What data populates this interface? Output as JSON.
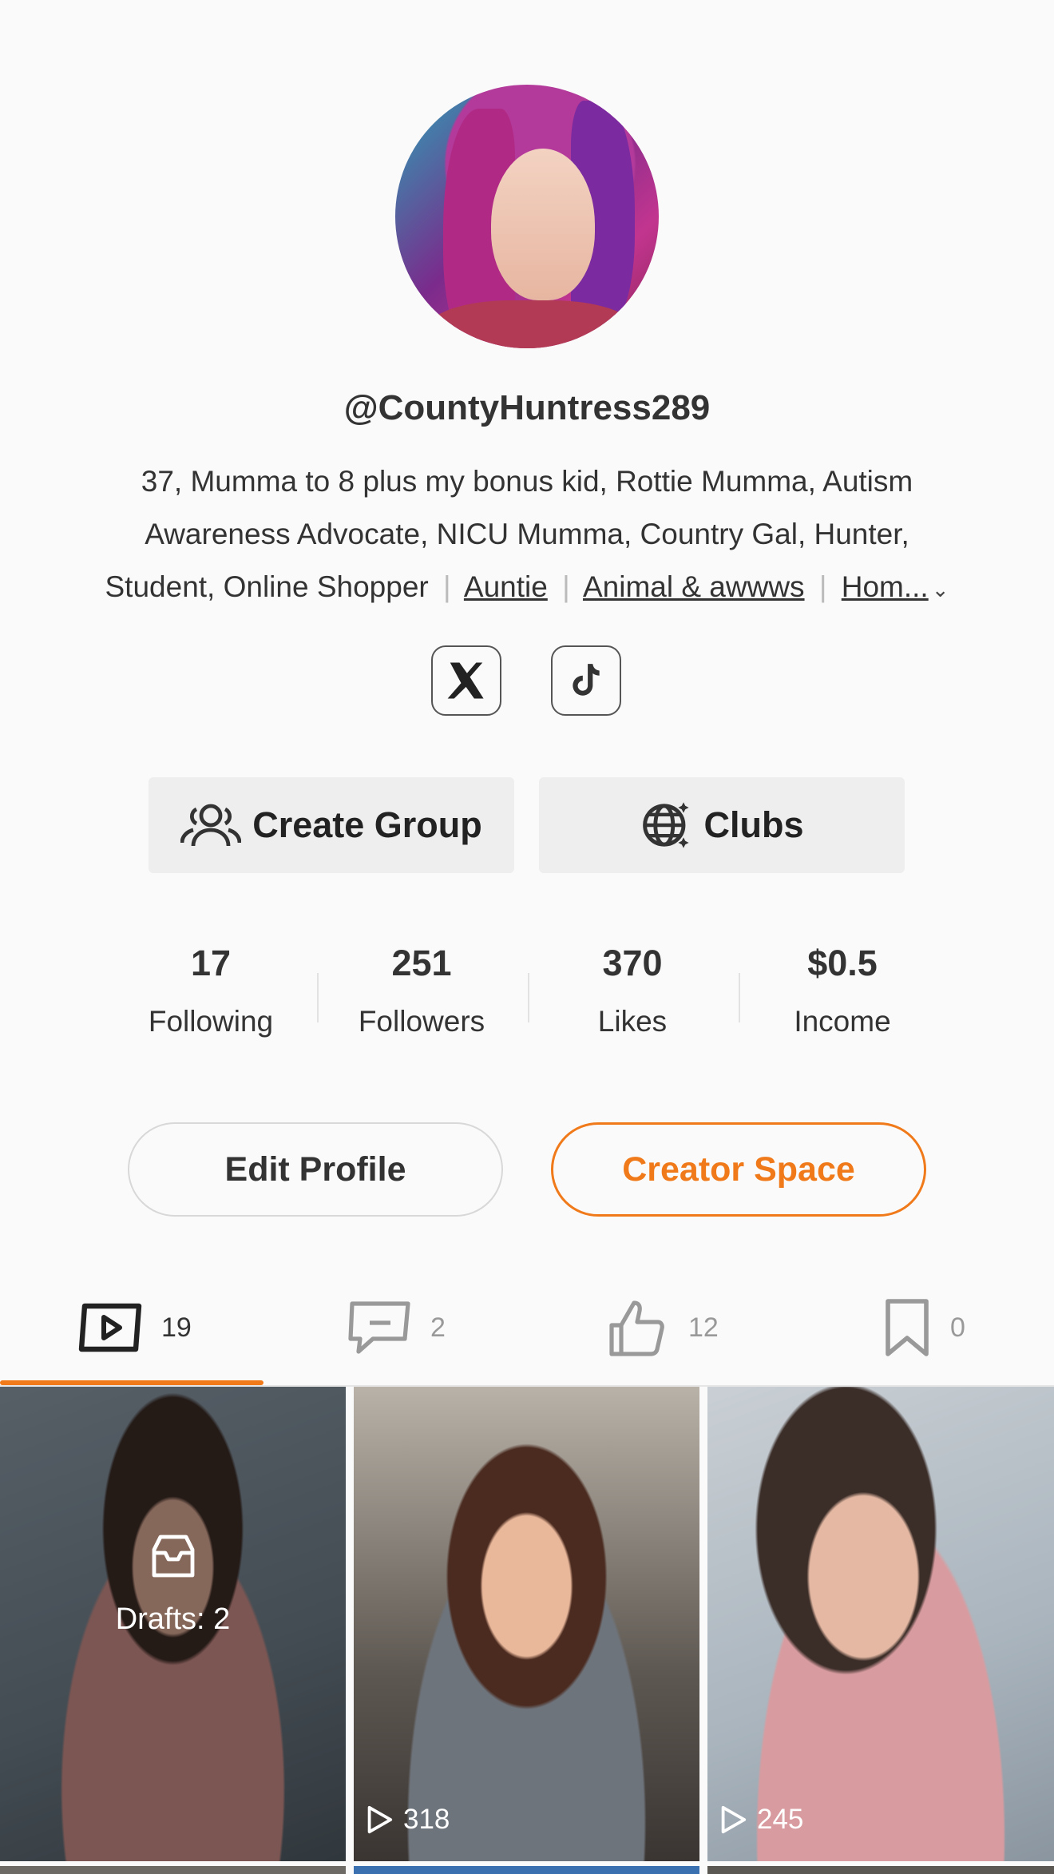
{
  "profile": {
    "username": "@CountyHuntress289",
    "bio_text": "37, Mumma to 8 plus my bonus kid, Rottie Mumma, Autism Awareness Advocate, NICU Mumma, Country Gal, Hunter, Student, Online Shopper",
    "tags": [
      "Auntie",
      "Animal & awwws",
      "Hom..."
    ]
  },
  "social": {
    "x_icon": "x-logo-icon",
    "tiktok_icon": "tiktok-logo-icon"
  },
  "actions": {
    "create_group": "Create Group",
    "clubs": "Clubs"
  },
  "stats": [
    {
      "value": "17",
      "label": "Following"
    },
    {
      "value": "251",
      "label": "Followers"
    },
    {
      "value": "370",
      "label": "Likes"
    },
    {
      "value": "$0.5",
      "label": "Income"
    }
  ],
  "buttons": {
    "edit_profile": "Edit Profile",
    "creator_space": "Creator Space"
  },
  "tabs": [
    {
      "icon": "video-play-icon",
      "count": "19",
      "active": true
    },
    {
      "icon": "comment-icon",
      "count": "2",
      "active": false
    },
    {
      "icon": "thumbs-up-icon",
      "count": "12",
      "active": false
    },
    {
      "icon": "bookmark-icon",
      "count": "0",
      "active": false
    }
  ],
  "videos": [
    {
      "drafts_label": "Drafts: 2"
    },
    {
      "views": "318"
    },
    {
      "views": "245"
    }
  ],
  "colors": {
    "accent": "#f07a1a",
    "background": "#fafafa"
  }
}
